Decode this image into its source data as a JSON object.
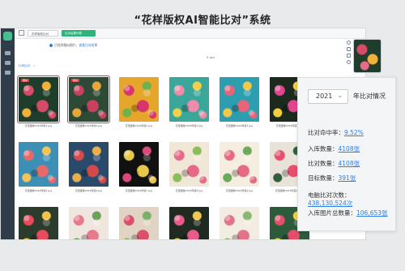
{
  "page_title": "“花样版权AI智能比对”系统",
  "topbar": {
    "tab_plain": "花样版权比对",
    "tab_active": "比对结果列表"
  },
  "notice": {
    "text": "已找到相似图片，",
    "link": "查看比对结果"
  },
  "result_count": "5 pcs",
  "breadcrumb": {
    "item": "片段比对",
    "sep": ">"
  },
  "tag_label": "相似",
  "thumbnails": [
    {
      "caption": "花型图像2018年新1.jpg",
      "colors": [
        "#1f3d2b",
        "#d84a6a",
        "#f0b13a"
      ],
      "selected": true
    },
    {
      "caption": "花型图像2018年新2.jpg",
      "colors": [
        "#2c4a36",
        "#c8425f",
        "#e8a63a"
      ],
      "selected": true
    },
    {
      "caption": "花型图像2018年度1.jpg",
      "colors": [
        "#e6a62c",
        "#d8366b",
        "#6db24b"
      ],
      "selected": false
    },
    {
      "caption": "花型图像2018年度2.jpg",
      "colors": [
        "#3aa79a",
        "#f08caa",
        "#f4d04a"
      ],
      "selected": false
    },
    {
      "caption": "花型图像2018年度3.jpg",
      "colors": [
        "#2d9eb0",
        "#e8647a",
        "#f2c84b"
      ],
      "selected": false
    },
    {
      "caption": "花型图像2018年度4.jpg",
      "colors": [
        "#1c2a1e",
        "#e2458f",
        "#f3d13c"
      ],
      "selected": false
    },
    {
      "caption": "花型图像2018年度5.jpg",
      "colors": [
        "#3c8fb5",
        "#e76a6a",
        "#f4c456"
      ],
      "selected": false
    },
    {
      "caption": "花型图像2018年度6.jpg",
      "colors": [
        "#294a6b",
        "#d44a4a",
        "#e9b04a"
      ],
      "selected": false
    },
    {
      "caption": "花型图像2018年度7.jpg",
      "colors": [
        "#111111",
        "#e8c84a",
        "#d94a7a"
      ],
      "selected": false
    },
    {
      "caption": "花型图像2018年度8.jpg",
      "colors": [
        "#f1e7d6",
        "#e56a8a",
        "#8bbd5b"
      ],
      "selected": false
    },
    {
      "caption": "花型图像2018年度9.jpg",
      "colors": [
        "#f4ede0",
        "#e66a84",
        "#6aaa5a"
      ],
      "selected": false
    },
    {
      "caption": "花型图像2018年度10.jpg",
      "colors": [
        "#e8e2d8",
        "#e6506e",
        "#2f5f3e"
      ],
      "selected": false
    },
    {
      "caption": "",
      "colors": [
        "#2b3b2c",
        "#e94a5e",
        "#f2c24a"
      ],
      "selected": false
    },
    {
      "caption": "",
      "colors": [
        "#f0e6e0",
        "#e47a8a",
        "#6aa05a"
      ],
      "selected": false
    },
    {
      "caption": "",
      "colors": [
        "#e2d4c4",
        "#d9506a",
        "#7ab06a"
      ],
      "selected": false
    },
    {
      "caption": "",
      "colors": [
        "#1f2a20",
        "#e85a8a",
        "#f0c850"
      ],
      "selected": false
    },
    {
      "caption": "",
      "colors": [
        "#f2ece2",
        "#e07488",
        "#8ab870"
      ],
      "selected": false
    },
    {
      "caption": "",
      "colors": [
        "#2c5a3a",
        "#e44e6a",
        "#f0d04a"
      ],
      "selected": false
    }
  ],
  "stats_panel": {
    "year": "2021",
    "year_suffix": "年比对情况",
    "rows": [
      {
        "label": "比对命中率：",
        "value": "9.52%"
      },
      {
        "label": "入库数量：",
        "value": "4108张"
      },
      {
        "label": "比对数量：",
        "value": "4108张"
      },
      {
        "label": "目标数量：",
        "value": "391张"
      },
      {
        "label": "电脑比对次数：",
        "value": "438,130,524次"
      },
      {
        "label": "入库图片总数量：",
        "value": "106,653张"
      }
    ]
  }
}
